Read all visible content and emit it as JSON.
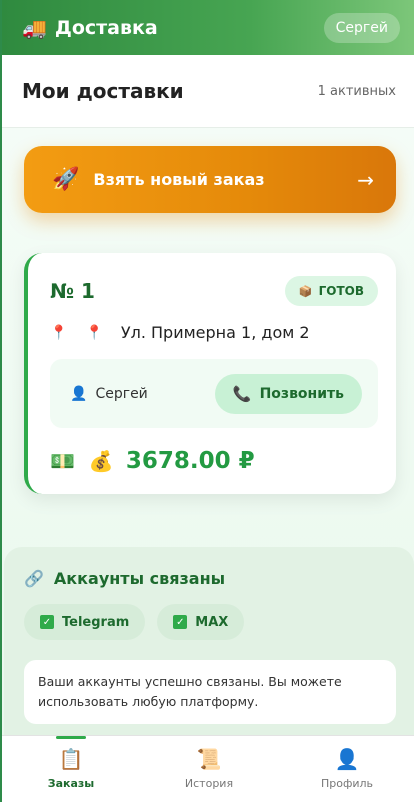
{
  "header": {
    "icon": "truck-icon",
    "title": "Доставка",
    "user": "Сергей"
  },
  "page": {
    "title": "Мои доставки",
    "active_count": "1 активных"
  },
  "take_order": {
    "icon": "rocket-icon",
    "label": "Взять новый заказ",
    "arrow": "→"
  },
  "order": {
    "number": "№ 1",
    "status": "ГОТОВ",
    "address": "Ул. Примерна 1, дом 2",
    "customer": "Сергей",
    "call_label": "Позвонить",
    "price": "3678.00 ₽"
  },
  "linked_accounts": {
    "title": "Аккаунты связаны",
    "platforms": [
      "Telegram",
      "MAX"
    ],
    "message": "Ваши аккаунты успешно связаны. Вы можете использовать любую платформу."
  },
  "nav": {
    "items": [
      {
        "label": "Заказы",
        "icon": "clipboard-icon",
        "active": true
      },
      {
        "label": "История",
        "icon": "scroll-icon",
        "active": false
      },
      {
        "label": "Профиль",
        "icon": "user-icon",
        "active": false
      }
    ]
  },
  "colors": {
    "primary_green": "#2f8a3f",
    "accent_orange": "#f39c12",
    "price_green": "#239a42"
  }
}
